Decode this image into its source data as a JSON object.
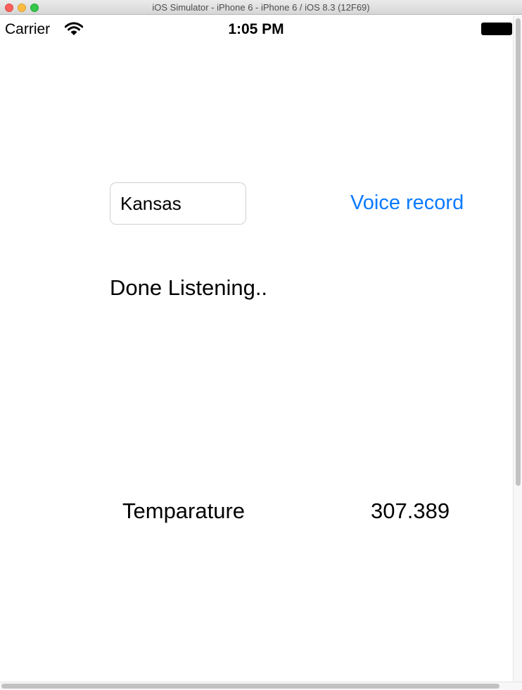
{
  "window": {
    "title": "iOS Simulator - iPhone 6 - iPhone 6 / iOS 8.3 (12F69)"
  },
  "status_bar": {
    "carrier": "Carrier",
    "time": "1:05 PM",
    "wifi_icon": "wifi-icon",
    "battery_icon": "battery-full-icon"
  },
  "form": {
    "city_value": "Kansas",
    "voice_button_label": "Voice record"
  },
  "listening_status": "Done Listening..",
  "result": {
    "label": "Temparature",
    "value": "307.389"
  },
  "colors": {
    "accent": "#0a7aff"
  }
}
